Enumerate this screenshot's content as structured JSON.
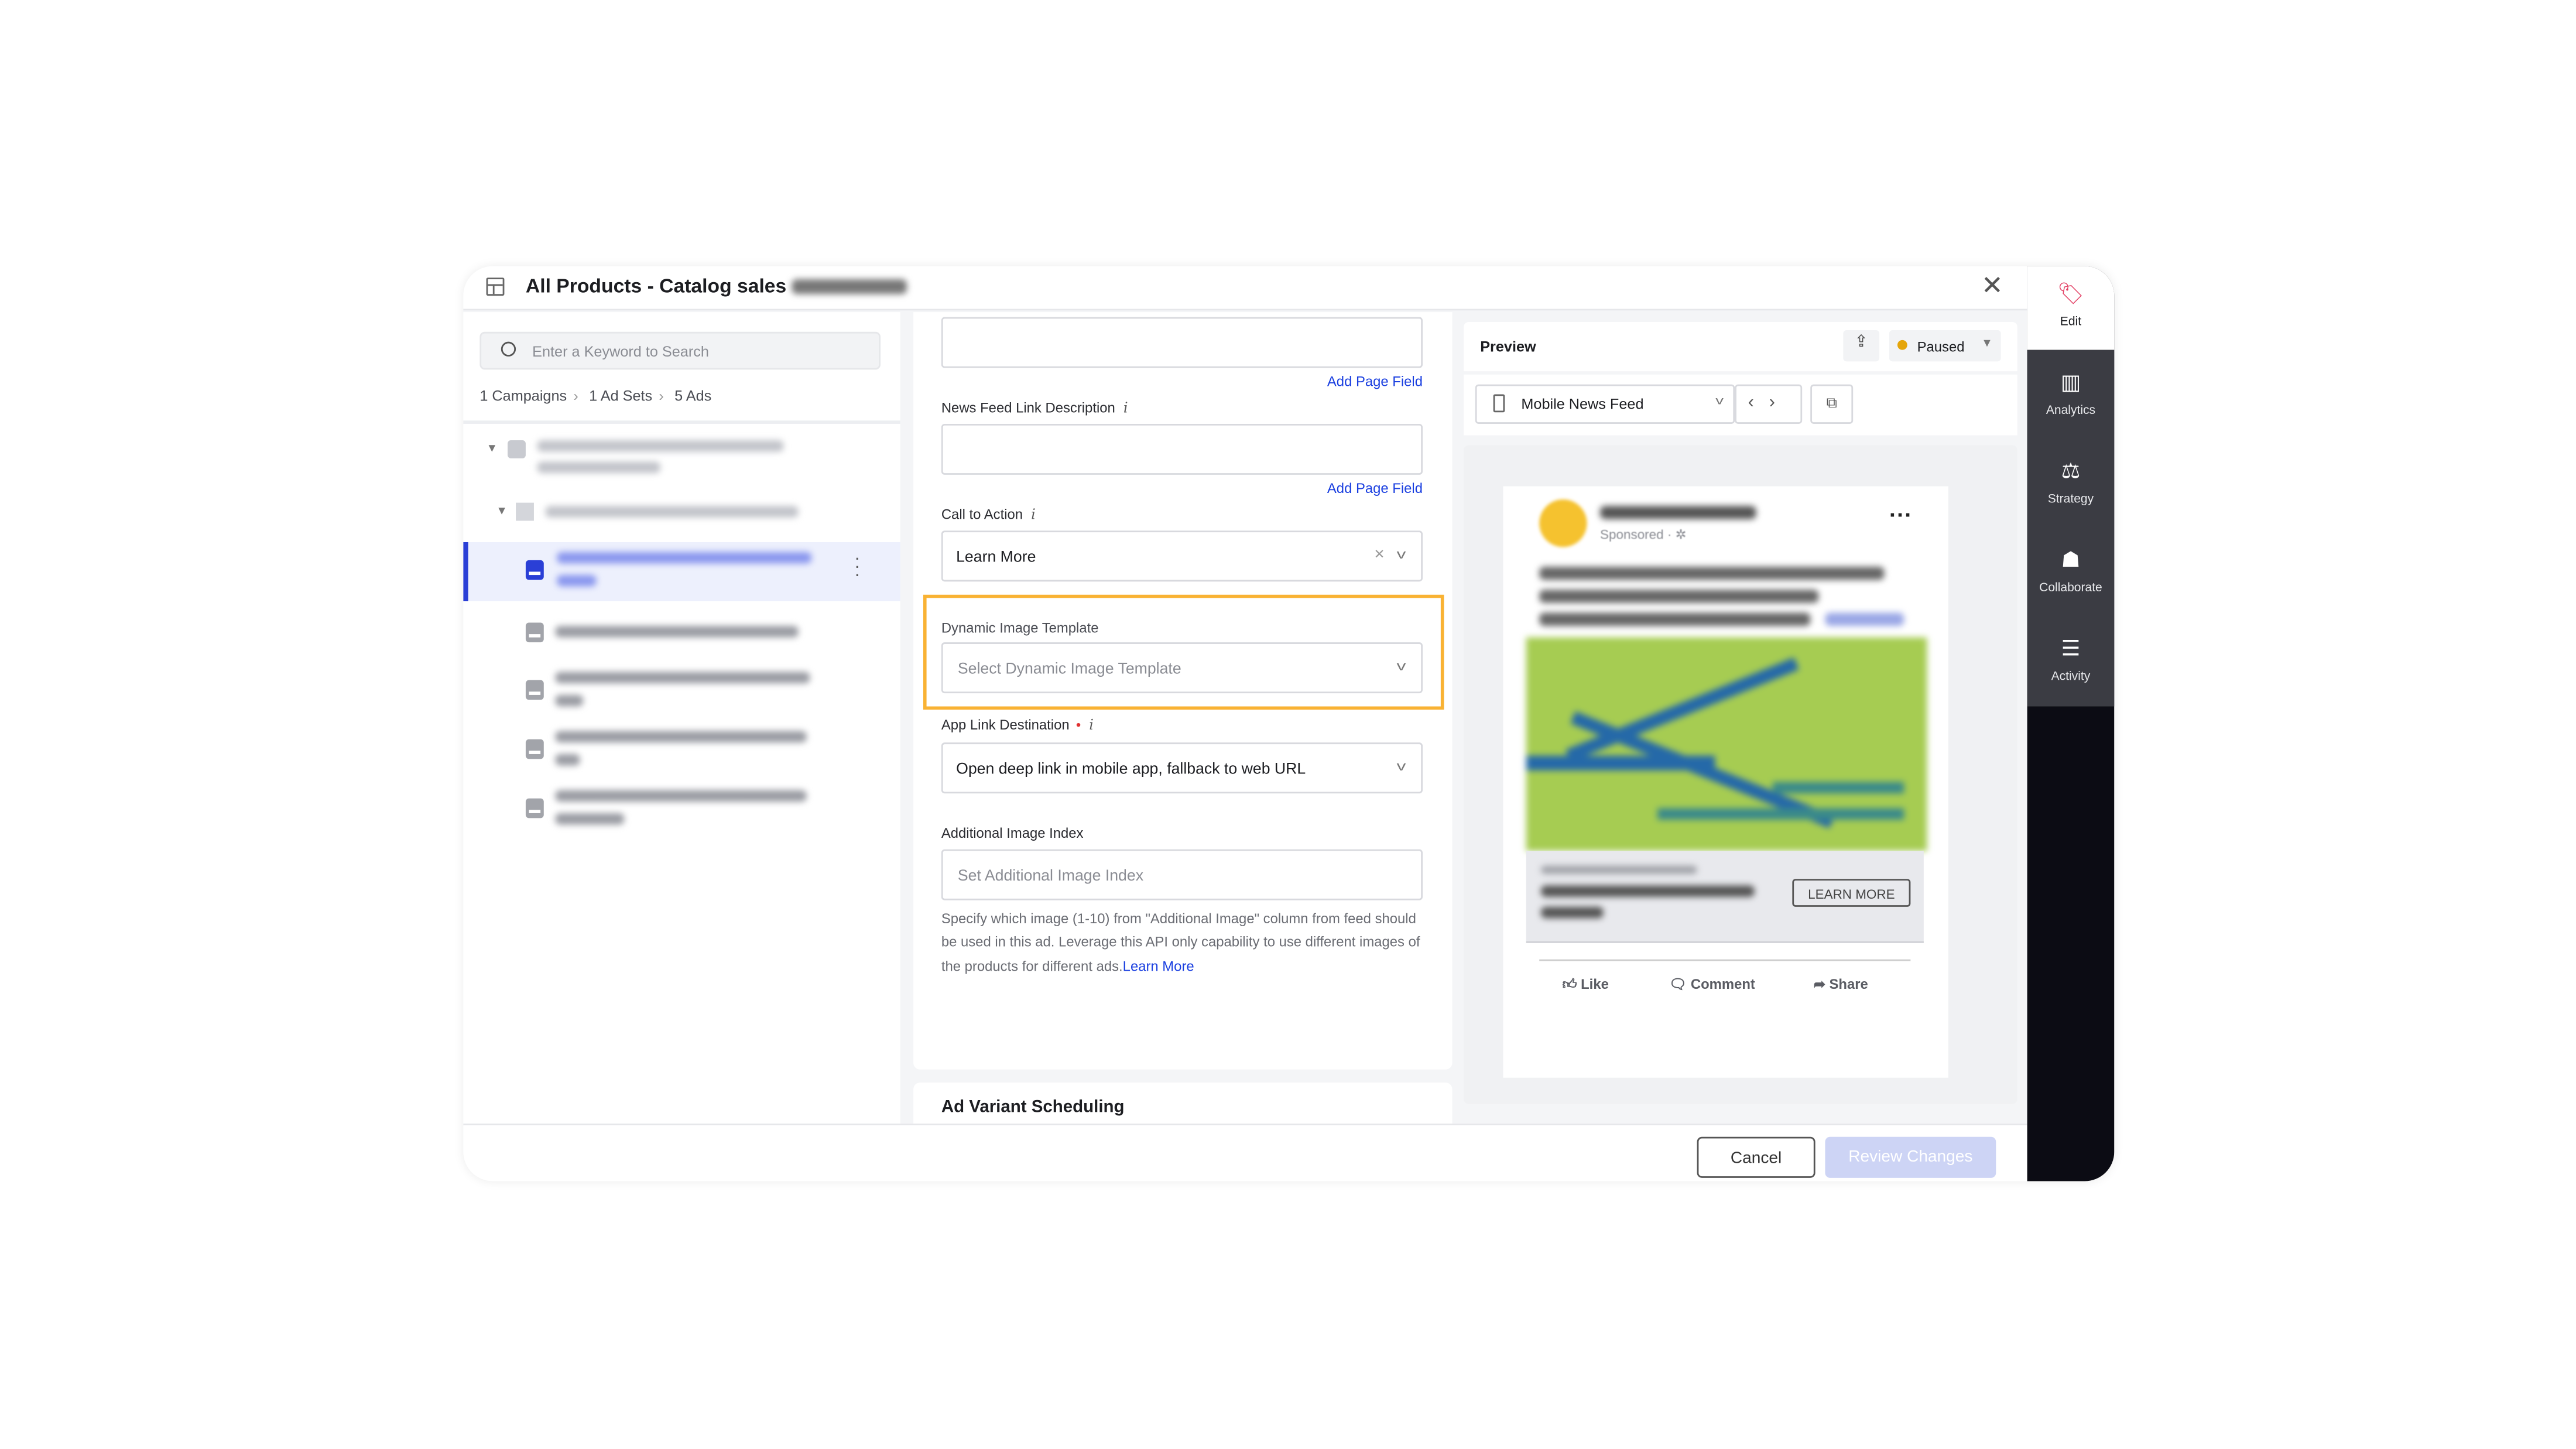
{
  "header": {
    "title": "All Products - Catalog sales",
    "close_icon": "close-icon",
    "layout_icon": "panel-layout-icon"
  },
  "left": {
    "search_placeholder": "Enter a Keyword to Search",
    "breadcrumb": [
      "1 Campaigns",
      "1 Ad Sets",
      "5 Ads"
    ]
  },
  "form": {
    "add_page_field": "Add Page Field",
    "news_feed_link_description": "News Feed Link Description",
    "info": "i",
    "call_to_action_label": "Call to Action",
    "call_to_action_value": "Learn More",
    "dynamic_image_template_label": "Dynamic Image Template",
    "dynamic_image_template_placeholder": "Select Dynamic Image Template",
    "app_link_destination_label": "App Link Destination",
    "app_link_destination_value": "Open deep link in mobile app, fallback to web URL",
    "additional_image_index_label": "Additional Image Index",
    "additional_image_index_placeholder": "Set Additional Image Index",
    "help_text": "Specify which image (1-10) from \"Additional Image\" column from feed should be used in this ad. Leverage this API only capability to use different images of the products for different ads.",
    "learn_more": "Learn More",
    "ad_variant_scheduling": "Ad Variant Scheduling",
    "highlight_color": "#f9b233"
  },
  "preview": {
    "title": "Preview",
    "status": "Paused",
    "status_color": "#e5a50a",
    "placement": "Mobile News Feed",
    "post": {
      "sponsored": "Sponsored",
      "cta": "LEARN MORE",
      "actions": [
        "Like",
        "Comment",
        "Share"
      ]
    }
  },
  "footer": {
    "cancel": "Cancel",
    "review": "Review Changes"
  },
  "rail": {
    "items": [
      "Edit",
      "Analytics",
      "Strategy",
      "Collaborate",
      "Activity"
    ]
  }
}
